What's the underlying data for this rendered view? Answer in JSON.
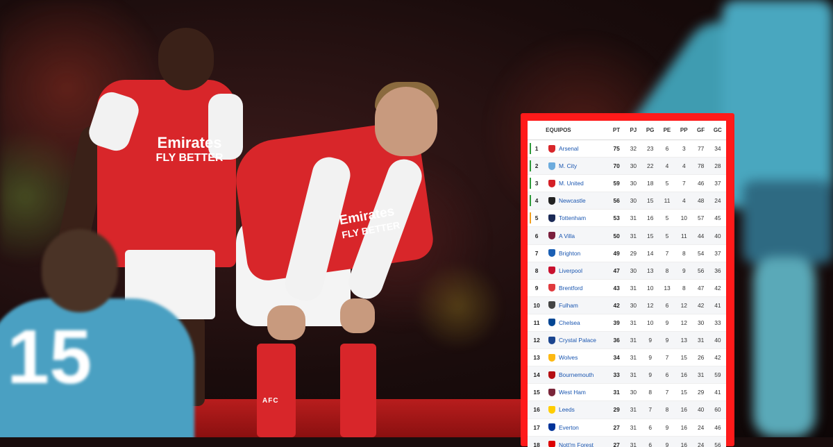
{
  "players": {
    "left_shirt_sponsor": "Emirates",
    "left_shirt_tagline": "FLY BETTER",
    "middle_shirt_sponsor": "Emirates",
    "middle_shirt_tagline": "FLY BETTER",
    "middle_sock_text": "AFC",
    "foreground_number": "15"
  },
  "colors": {
    "frame": "#ff1a1a",
    "home_red": "#d8262a",
    "away_teal": "#4aa0c2",
    "team_link": "#1a56b0"
  },
  "table": {
    "headers": {
      "team": "EQUIPOS",
      "pt": "PT",
      "pj": "PJ",
      "pg": "PG",
      "pe": "PE",
      "pp": "PP",
      "gf": "GF",
      "gc": "GC"
    },
    "rows": [
      {
        "pos": "1",
        "team": "Arsenal",
        "pt": "75",
        "pj": "32",
        "pg": "23",
        "pe": "6",
        "pp": "3",
        "gf": "77",
        "gc": "34",
        "crest": "#d8262a",
        "marker": "#2e9a3a"
      },
      {
        "pos": "2",
        "team": "M. City",
        "pt": "70",
        "pj": "30",
        "pg": "22",
        "pe": "4",
        "pp": "4",
        "gf": "78",
        "gc": "28",
        "crest": "#6cabdd",
        "marker": "#2e9a3a"
      },
      {
        "pos": "3",
        "team": "M. United",
        "pt": "59",
        "pj": "30",
        "pg": "18",
        "pe": "5",
        "pp": "7",
        "gf": "46",
        "gc": "37",
        "crest": "#d41f26",
        "marker": "#2e9a3a"
      },
      {
        "pos": "4",
        "team": "Newcastle",
        "pt": "56",
        "pj": "30",
        "pg": "15",
        "pe": "11",
        "pp": "4",
        "gf": "48",
        "gc": "24",
        "crest": "#222222",
        "marker": "#2e9a3a"
      },
      {
        "pos": "5",
        "team": "Tottenham",
        "pt": "53",
        "pj": "31",
        "pg": "16",
        "pe": "5",
        "pp": "10",
        "gf": "57",
        "gc": "45",
        "crest": "#1b2a56",
        "marker": "#f0a020"
      },
      {
        "pos": "6",
        "team": "A Villa",
        "pt": "50",
        "pj": "31",
        "pg": "15",
        "pe": "5",
        "pp": "11",
        "gf": "44",
        "gc": "40",
        "crest": "#7a1e3c",
        "marker": ""
      },
      {
        "pos": "7",
        "team": "Brighton",
        "pt": "49",
        "pj": "29",
        "pg": "14",
        "pe": "7",
        "pp": "8",
        "gf": "54",
        "gc": "37",
        "crest": "#1a5fb4",
        "marker": ""
      },
      {
        "pos": "8",
        "team": "Liverpool",
        "pt": "47",
        "pj": "30",
        "pg": "13",
        "pe": "8",
        "pp": "9",
        "gf": "56",
        "gc": "36",
        "crest": "#c8102e",
        "marker": ""
      },
      {
        "pos": "9",
        "team": "Brentford",
        "pt": "43",
        "pj": "31",
        "pg": "10",
        "pe": "13",
        "pp": "8",
        "gf": "47",
        "gc": "42",
        "crest": "#e03a3e",
        "marker": ""
      },
      {
        "pos": "10",
        "team": "Fulham",
        "pt": "42",
        "pj": "30",
        "pg": "12",
        "pe": "6",
        "pp": "12",
        "gf": "42",
        "gc": "41",
        "crest": "#444444",
        "marker": ""
      },
      {
        "pos": "11",
        "team": "Chelsea",
        "pt": "39",
        "pj": "31",
        "pg": "10",
        "pe": "9",
        "pp": "12",
        "gf": "30",
        "gc": "33",
        "crest": "#034694",
        "marker": ""
      },
      {
        "pos": "12",
        "team": "Crystal Palace",
        "pt": "36",
        "pj": "31",
        "pg": "9",
        "pe": "9",
        "pp": "13",
        "gf": "31",
        "gc": "40",
        "crest": "#1b458f",
        "marker": ""
      },
      {
        "pos": "13",
        "team": "Wolves",
        "pt": "34",
        "pj": "31",
        "pg": "9",
        "pe": "7",
        "pp": "15",
        "gf": "26",
        "gc": "42",
        "crest": "#fdb913",
        "marker": ""
      },
      {
        "pos": "14",
        "team": "Bournemouth",
        "pt": "33",
        "pj": "31",
        "pg": "9",
        "pe": "6",
        "pp": "16",
        "gf": "31",
        "gc": "59",
        "crest": "#b50e12",
        "marker": ""
      },
      {
        "pos": "15",
        "team": "West Ham",
        "pt": "31",
        "pj": "30",
        "pg": "8",
        "pe": "7",
        "pp": "15",
        "gf": "29",
        "gc": "41",
        "crest": "#7a263a",
        "marker": ""
      },
      {
        "pos": "16",
        "team": "Leeds",
        "pt": "29",
        "pj": "31",
        "pg": "7",
        "pe": "8",
        "pp": "16",
        "gf": "40",
        "gc": "60",
        "crest": "#ffcd00",
        "marker": ""
      },
      {
        "pos": "17",
        "team": "Everton",
        "pt": "27",
        "pj": "31",
        "pg": "6",
        "pe": "9",
        "pp": "16",
        "gf": "24",
        "gc": "46",
        "crest": "#003399",
        "marker": ""
      },
      {
        "pos": "18",
        "team": "Nott'm Forest",
        "pt": "27",
        "pj": "31",
        "pg": "6",
        "pe": "9",
        "pp": "16",
        "gf": "24",
        "gc": "56",
        "crest": "#dd0000",
        "marker": ""
      }
    ]
  }
}
